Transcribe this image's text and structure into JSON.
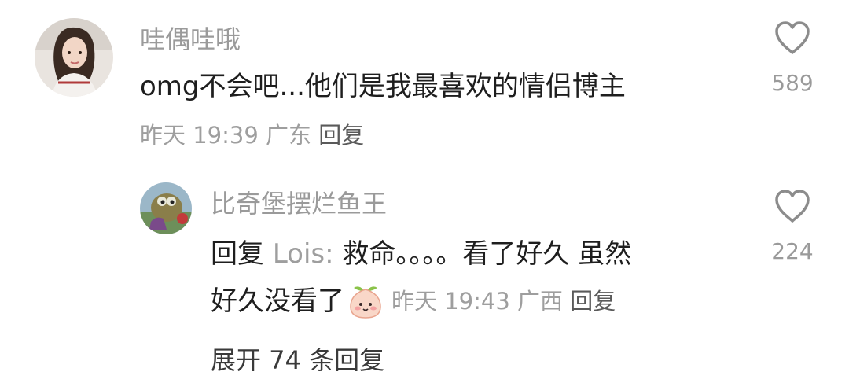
{
  "comment": {
    "username": "哇偶哇哦",
    "text": "omg不会吧...他们是我最喜欢的情侣博主",
    "time": "昨天 19:39",
    "location": "广东",
    "reply_label": "回复",
    "likes": "589"
  },
  "reply": {
    "username": "比奇堡摆烂鱼王",
    "prefix": "回复",
    "reply_to": "Lois:",
    "text_line1": "救命。。。。看了好久 虽然",
    "text_line2": "好久没看了",
    "emoji_icon": "peach-face-emoji",
    "time": "昨天 19:43",
    "location": "广西",
    "reply_label": "回复",
    "likes": "224"
  },
  "expand": {
    "label": "展开 74 条回复"
  },
  "icons": {
    "like": "heart-outline-icon"
  }
}
